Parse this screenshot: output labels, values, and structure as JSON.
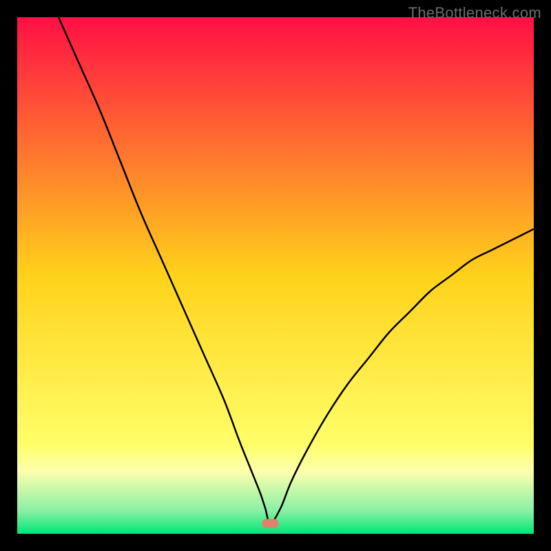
{
  "watermark": "TheBottleneck.com",
  "chart_data": {
    "type": "line",
    "title": "",
    "xlabel": "",
    "ylabel": "",
    "xlim": [
      0,
      100
    ],
    "ylim": [
      0,
      100
    ],
    "grid": false,
    "legend": false,
    "background_gradient": {
      "stops": [
        {
          "pos": 0.0,
          "color": "#ff0f44"
        },
        {
          "pos": 0.5,
          "color": "#ffd21a"
        },
        {
          "pos": 0.83,
          "color": "#ffff6a"
        },
        {
          "pos": 0.88,
          "color": "#fbffae"
        },
        {
          "pos": 0.955,
          "color": "#8af0a4"
        },
        {
          "pos": 1.0,
          "color": "#00e676"
        }
      ]
    },
    "marker": {
      "x": 49.0,
      "y": 2.0,
      "color": "#e0816b"
    },
    "series": [
      {
        "name": "curve",
        "color": "#000000",
        "stroke_width": 2.5,
        "x": [
          8,
          12,
          16,
          20,
          24,
          28,
          32,
          36,
          40,
          43,
          45,
          47,
          48,
          49,
          51,
          53,
          56,
          60,
          64,
          68,
          72,
          76,
          80,
          84,
          88,
          92,
          96,
          100
        ],
        "values": [
          100,
          91,
          82,
          72,
          62,
          53,
          44,
          35,
          26,
          18,
          13,
          8,
          5,
          2.0,
          5,
          10,
          16,
          23,
          29,
          34,
          39,
          43,
          47,
          50,
          53,
          55,
          57,
          59
        ]
      }
    ]
  }
}
